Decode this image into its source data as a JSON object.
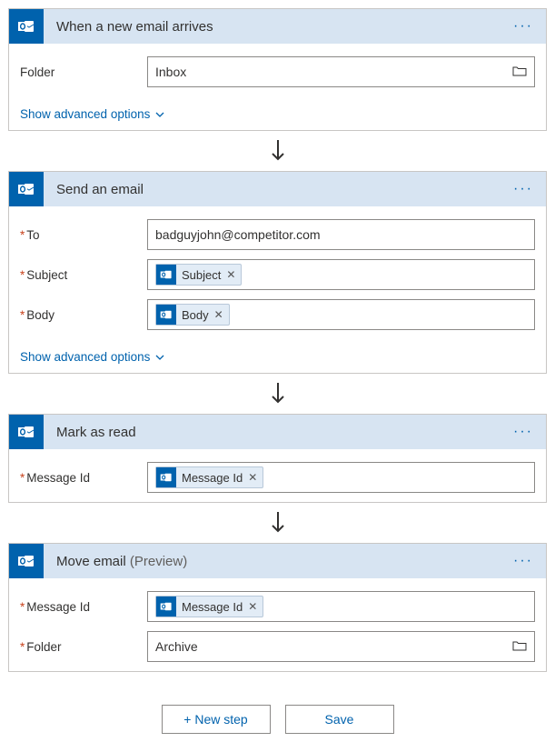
{
  "cards": [
    {
      "title": "When a new email arrives",
      "preview": "",
      "rows": [
        {
          "label": "Folder",
          "required": false,
          "value": "Inbox",
          "type": "folder"
        }
      ],
      "showAdvanced": true
    },
    {
      "title": "Send an email",
      "preview": "",
      "rows": [
        {
          "label": "To",
          "required": true,
          "value": "badguyjohn@competitor.com",
          "type": "text"
        },
        {
          "label": "Subject",
          "required": true,
          "token": "Subject",
          "type": "token"
        },
        {
          "label": "Body",
          "required": true,
          "token": "Body",
          "type": "token"
        }
      ],
      "showAdvanced": true
    },
    {
      "title": "Mark as read",
      "preview": "",
      "rows": [
        {
          "label": "Message Id",
          "required": true,
          "token": "Message Id",
          "type": "token"
        }
      ],
      "showAdvanced": false
    },
    {
      "title": "Move email",
      "preview": "(Preview)",
      "rows": [
        {
          "label": "Message Id",
          "required": true,
          "token": "Message Id",
          "type": "token"
        },
        {
          "label": "Folder",
          "required": true,
          "value": "Archive",
          "type": "folder"
        }
      ],
      "showAdvanced": false
    }
  ],
  "advancedLabel": "Show advanced options",
  "buttons": {
    "newStep": "+ New step",
    "save": "Save"
  }
}
